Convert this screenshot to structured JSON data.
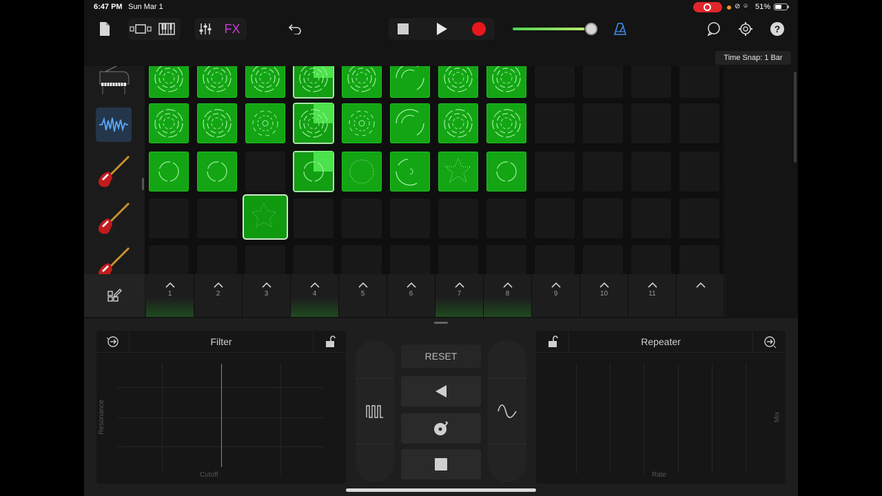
{
  "status_bar": {
    "time": "6:47 PM",
    "date": "Sun Mar 1",
    "battery": "51%",
    "icons": "⊘ ⌾"
  },
  "toolbar": {
    "fx_label": "FX",
    "volume_level": 0.9,
    "time_snap": "Time Snap: 1 Bar",
    "accent_color": "#c73bd6",
    "record_color": "#e0252b"
  },
  "tracks": [
    {
      "name": "piano-icon"
    },
    {
      "name": "waveform-icon"
    },
    {
      "name": "bass-guitar-icon"
    },
    {
      "name": "bass-guitar-icon"
    },
    {
      "name": "bass-guitar-icon"
    }
  ],
  "grid": {
    "columns": 12,
    "rows": [
      {
        "cells": [
          "rings",
          "rings",
          "rings",
          "rings-active",
          "rings",
          "arcs",
          "rings",
          "rings",
          "empty",
          "empty",
          "empty",
          "empty"
        ]
      },
      {
        "cells": [
          "rings",
          "rings",
          "dots",
          "rings-active",
          "dots",
          "arcs",
          "rings",
          "rings",
          "empty",
          "empty",
          "empty",
          "empty"
        ]
      },
      {
        "cells": [
          "circle",
          "circle",
          "empty",
          "circle-active",
          "dotted",
          "arc",
          "star",
          "circle",
          "empty",
          "empty",
          "empty",
          "empty"
        ]
      },
      {
        "cells": [
          "empty",
          "empty",
          "selected",
          "empty",
          "empty",
          "empty",
          "empty",
          "empty",
          "empty",
          "empty",
          "empty",
          "empty"
        ]
      },
      {
        "cells": [
          "empty",
          "empty",
          "empty",
          "empty",
          "empty",
          "empty",
          "empty",
          "empty",
          "empty",
          "empty",
          "empty",
          "empty"
        ]
      }
    ]
  },
  "scenes": [
    {
      "num": "1",
      "green": true
    },
    {
      "num": "2",
      "green": false
    },
    {
      "num": "3",
      "green": false
    },
    {
      "num": "4",
      "green": true
    },
    {
      "num": "5",
      "green": false
    },
    {
      "num": "6",
      "green": false
    },
    {
      "num": "7",
      "green": true
    },
    {
      "num": "8",
      "green": true
    },
    {
      "num": "9",
      "green": false
    },
    {
      "num": "10",
      "green": false
    },
    {
      "num": "11",
      "green": false
    },
    {
      "num": "",
      "green": false
    }
  ],
  "fx": {
    "left": {
      "title": "Filter",
      "x_axis": "Cutoff",
      "y_axis": "Resonance"
    },
    "right": {
      "title": "Repeater",
      "x_axis": "Rate",
      "y_axis": "Mix"
    },
    "reset_label": "RESET"
  }
}
